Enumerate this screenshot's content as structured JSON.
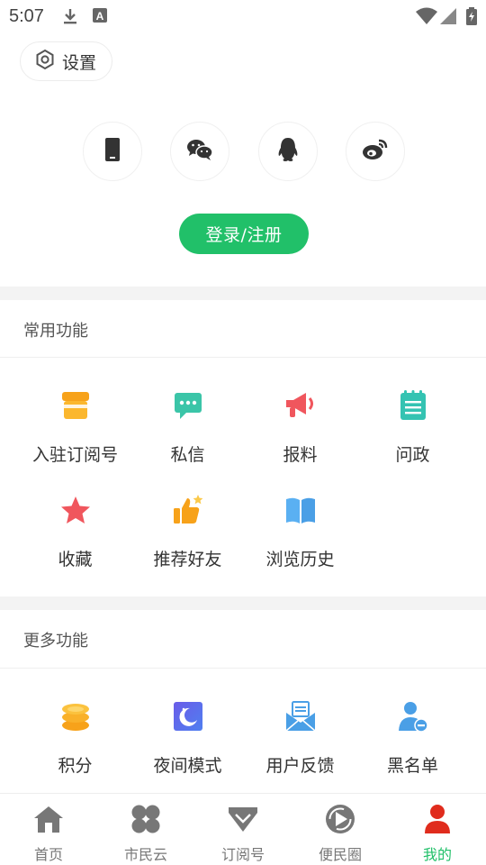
{
  "status_bar": {
    "time": "5:07",
    "icons": [
      "download-icon",
      "keyboard-a-icon",
      "wifi-icon",
      "signal-icon",
      "battery-icon"
    ]
  },
  "header": {
    "settings_label": "设置",
    "settings_icon": "hexagon-settings-icon",
    "social_logins": [
      "phone-icon",
      "wechat-icon",
      "qq-icon",
      "weibo-icon"
    ],
    "login_label": "登录/注册"
  },
  "common": {
    "title": "常用功能",
    "items": [
      {
        "label": "入驻订阅号",
        "icon": "storefront-icon"
      },
      {
        "label": "私信",
        "icon": "message-icon"
      },
      {
        "label": "报料",
        "icon": "megaphone-icon"
      },
      {
        "label": "问政",
        "icon": "notepad-icon"
      },
      {
        "label": "收藏",
        "icon": "star-icon"
      },
      {
        "label": "推荐好友",
        "icon": "thumbs-up-icon"
      },
      {
        "label": "浏览历史",
        "icon": "open-book-icon"
      }
    ]
  },
  "more": {
    "title": "更多功能",
    "items": [
      {
        "label": "积分",
        "icon": "coins-icon"
      },
      {
        "label": "夜间模式",
        "icon": "moon-icon"
      },
      {
        "label": "用户反馈",
        "icon": "mail-feedback-icon"
      },
      {
        "label": "黑名单",
        "icon": "user-block-icon"
      }
    ]
  },
  "tabs": [
    {
      "label": "首页",
      "icon": "home-icon",
      "active": false
    },
    {
      "label": "市民云",
      "icon": "clover-icon",
      "active": false
    },
    {
      "label": "订阅号",
      "icon": "diamond-icon",
      "active": false
    },
    {
      "label": "便民圈",
      "icon": "circle-play-icon",
      "active": false
    },
    {
      "label": "我的",
      "icon": "person-icon",
      "active": true
    }
  ],
  "colors": {
    "accent": "#21c069",
    "active_tab_icon": "#e02c1d",
    "inactive_tab": "#777777"
  }
}
